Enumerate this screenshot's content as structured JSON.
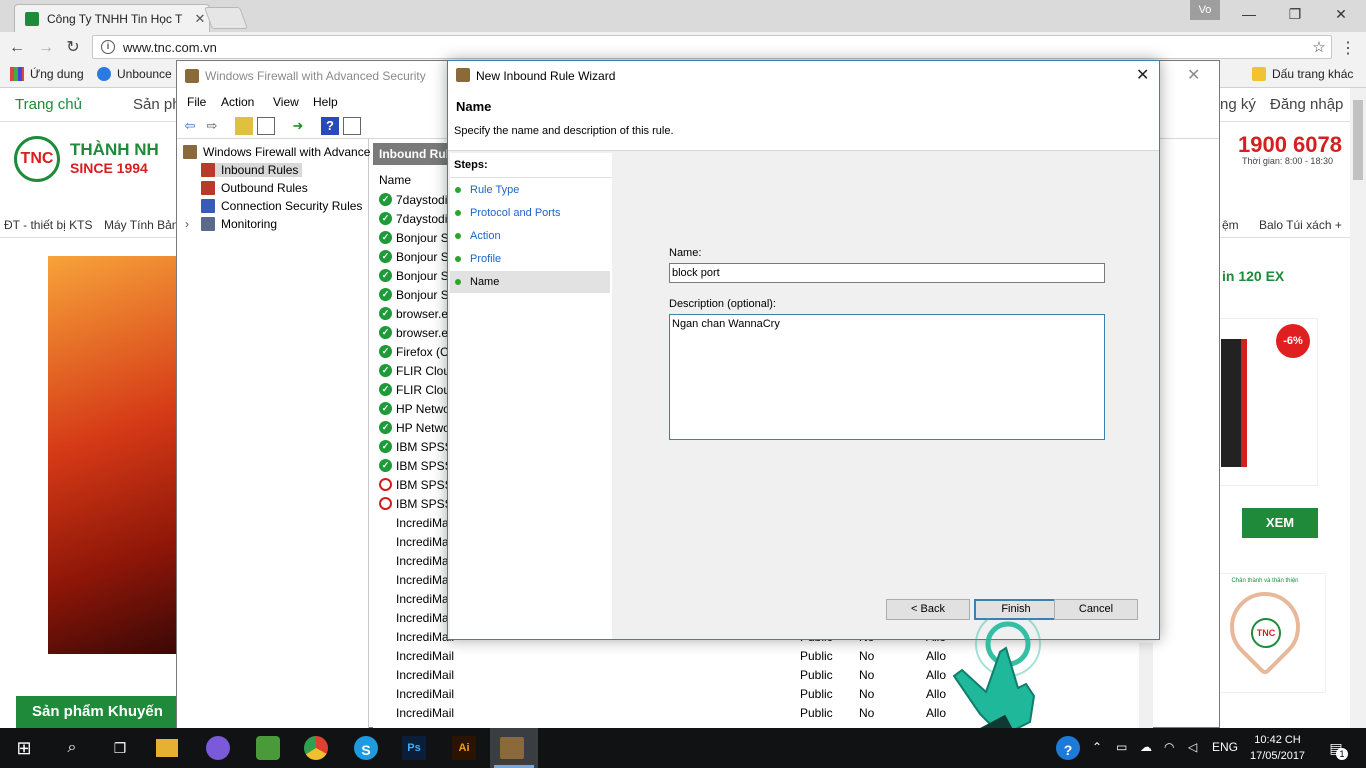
{
  "browser": {
    "tab_title": "Công Ty TNHH Tin Học T",
    "url": "www.tnc.com.vn",
    "user_badge": "Vo",
    "bookmarks": [
      "Ứng dung",
      "Unbounce"
    ],
    "other_bookmarks": "Dấu trang khác"
  },
  "site": {
    "nav": [
      "Trang chủ",
      "Sản ph",
      "ng ký",
      "Đăng nhập"
    ],
    "brand_line1": "THÀNH NH",
    "brand_line2": "SINCE 1994",
    "logo_text": "TNC",
    "hotline": "1900 6078",
    "hotline_hours": "Thời gian: 8:00 - 18:30",
    "categories": [
      "ĐT - thiết bị KTS",
      "Máy Tính Bản",
      "ệm",
      "Balo Túi xách +"
    ],
    "side_title": "in 120 EX",
    "sale_badge": "-6%",
    "xem_button": "XEM",
    "heart_tag": "Chân thành và thân thiện",
    "promo": "Sản phẩm Khuyến"
  },
  "mmc": {
    "title": "Windows Firewall with Advanced Security",
    "menu": [
      "File",
      "Action",
      "View",
      "Help"
    ],
    "tree": {
      "root": "Windows Firewall with Advance",
      "items": [
        "Inbound Rules",
        "Outbound Rules",
        "Connection Security Rules",
        "Monitoring"
      ]
    },
    "list_header": "Inbound Rul",
    "column_name": "Name",
    "rows": [
      {
        "name": "7daystodi",
        "status": "ok",
        "profile": "",
        "override": "",
        "action": ""
      },
      {
        "name": "7daystodi",
        "status": "ok",
        "profile": "",
        "override": "",
        "action": ""
      },
      {
        "name": "Bonjour S",
        "status": "ok",
        "profile": "",
        "override": "",
        "action": ""
      },
      {
        "name": "Bonjour S",
        "status": "ok",
        "profile": "",
        "override": "",
        "action": ""
      },
      {
        "name": "Bonjour S",
        "status": "ok",
        "profile": "",
        "override": "",
        "action": ""
      },
      {
        "name": "Bonjour S",
        "status": "ok",
        "profile": "",
        "override": "",
        "action": ""
      },
      {
        "name": "browser.e",
        "status": "ok",
        "profile": "",
        "override": "",
        "action": ""
      },
      {
        "name": "browser.e",
        "status": "ok",
        "profile": "",
        "override": "",
        "action": ""
      },
      {
        "name": "Firefox (C",
        "status": "ok",
        "profile": "",
        "override": "",
        "action": ""
      },
      {
        "name": "FLIR Clou",
        "status": "ok",
        "profile": "",
        "override": "",
        "action": ""
      },
      {
        "name": "FLIR Clou",
        "status": "ok",
        "profile": "",
        "override": "",
        "action": ""
      },
      {
        "name": "HP Netwo",
        "status": "ok",
        "profile": "",
        "override": "",
        "action": ""
      },
      {
        "name": "HP Netwo",
        "status": "ok",
        "profile": "",
        "override": "",
        "action": ""
      },
      {
        "name": "IBM SPSS",
        "status": "ok",
        "profile": "",
        "override": "",
        "action": ""
      },
      {
        "name": "IBM SPSS",
        "status": "ok",
        "profile": "",
        "override": "",
        "action": ""
      },
      {
        "name": "IBM SPSS",
        "status": "no",
        "profile": "",
        "override": "",
        "action": ""
      },
      {
        "name": "IBM SPSS",
        "status": "no",
        "profile": "",
        "override": "",
        "action": ""
      },
      {
        "name": "IncrediMai",
        "status": "",
        "profile": "",
        "override": "",
        "action": ""
      },
      {
        "name": "IncrediMai",
        "status": "",
        "profile": "",
        "override": "",
        "action": ""
      },
      {
        "name": "IncrediMai",
        "status": "",
        "profile": "",
        "override": "",
        "action": ""
      },
      {
        "name": "IncrediMai",
        "status": "",
        "profile": "",
        "override": "",
        "action": ""
      },
      {
        "name": "IncrediMai",
        "status": "",
        "profile": "",
        "override": "",
        "action": ""
      },
      {
        "name": "IncrediMai",
        "status": "",
        "profile": "",
        "override": "",
        "action": ""
      },
      {
        "name": "IncrediMail",
        "status": "",
        "profile": "Public",
        "override": "No",
        "action": "Allo"
      },
      {
        "name": "IncrediMail",
        "status": "",
        "profile": "Public",
        "override": "No",
        "action": "Allo"
      },
      {
        "name": "IncrediMail",
        "status": "",
        "profile": "Public",
        "override": "No",
        "action": "Allo"
      },
      {
        "name": "IncrediMail",
        "status": "",
        "profile": "Public",
        "override": "No",
        "action": "Allo"
      },
      {
        "name": "IncrediMail",
        "status": "",
        "profile": "Public",
        "override": "No",
        "action": "Allo"
      }
    ]
  },
  "wizard": {
    "title": "New Inbound Rule Wizard",
    "heading": "Name",
    "subheading": "Specify the name and description of this rule.",
    "steps_label": "Steps:",
    "steps": [
      "Rule Type",
      "Protocol and Ports",
      "Action",
      "Profile",
      "Name"
    ],
    "current_step": "Name",
    "name_label": "Name:",
    "name_value": "block port",
    "desc_label": "Description (optional):",
    "desc_value": "Ngan chan WannaCry",
    "back_button": "< Back",
    "finish_button": "Finish",
    "cancel_button": "Cancel"
  },
  "taskbar": {
    "language": "ENG",
    "time": "10:42 CH",
    "date": "17/05/2017",
    "notification_count": "1"
  },
  "colors": {
    "site_green": "#1e8a3a",
    "site_red": "#d62020",
    "wizard_border": "#3c7fb1",
    "step_link": "#1e64c8"
  }
}
